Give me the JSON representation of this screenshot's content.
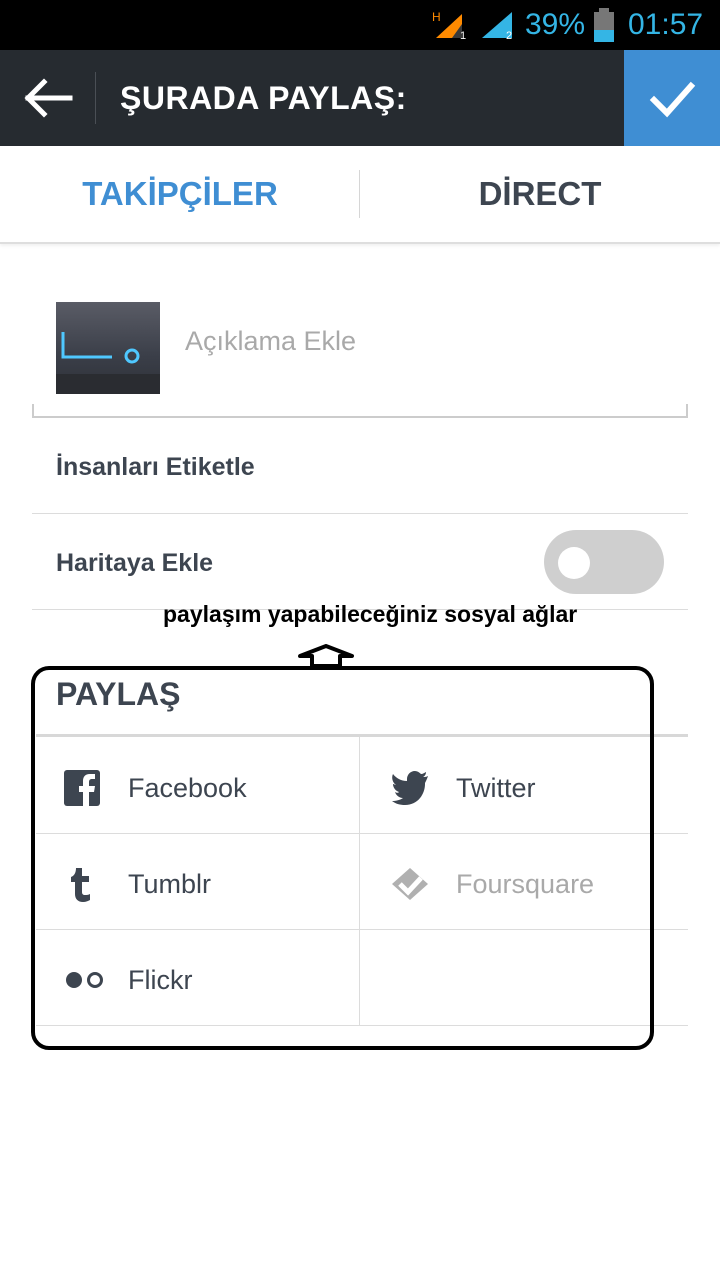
{
  "status_bar": {
    "battery_percent": "39%",
    "time": "01:57",
    "accent_color": "#34b5e5"
  },
  "action_bar": {
    "title": "ŞURADA PAYLAŞ:",
    "back_icon": "arrow-left-icon",
    "confirm_icon": "check-icon",
    "confirm_color": "#3f8ed3"
  },
  "tabs": [
    {
      "label": "TAKİPÇİLER",
      "active": true
    },
    {
      "label": "DİRECT",
      "active": false
    }
  ],
  "caption": {
    "placeholder": "Açıklama Ekle"
  },
  "options": {
    "tag_people": "İnsanları Etiketle",
    "add_to_map": "Haritaya Ekle",
    "add_to_map_enabled": false
  },
  "annotation": {
    "text": "paylaşım yapabileceğiniz sosyal ağlar"
  },
  "share": {
    "heading": "PAYLAŞ",
    "networks": [
      {
        "label": "Facebook",
        "icon": "facebook-icon",
        "enabled": true
      },
      {
        "label": "Twitter",
        "icon": "twitter-icon",
        "enabled": true
      },
      {
        "label": "Tumblr",
        "icon": "tumblr-icon",
        "enabled": true
      },
      {
        "label": "Foursquare",
        "icon": "foursquare-icon",
        "enabled": false
      },
      {
        "label": "Flickr",
        "icon": "flickr-icon",
        "enabled": true
      }
    ]
  }
}
